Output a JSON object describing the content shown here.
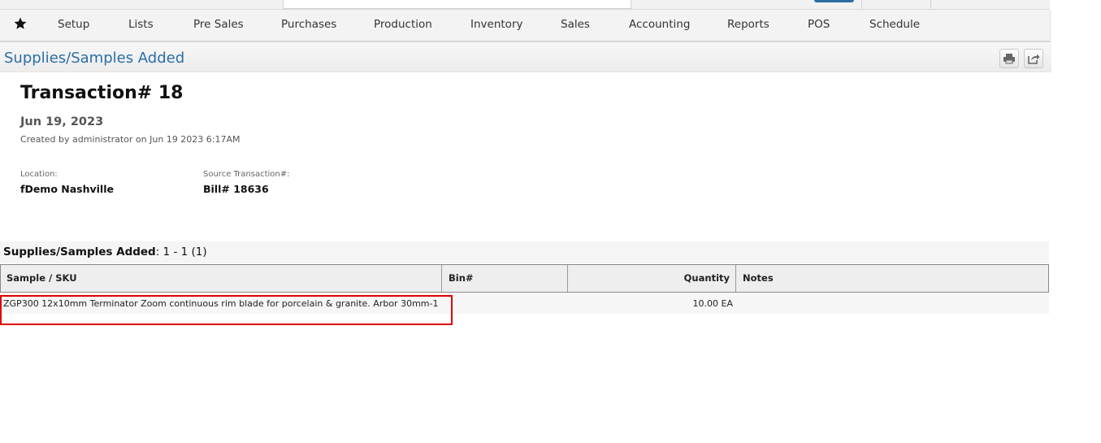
{
  "nav": {
    "favorites_icon": "star-icon",
    "items": [
      "Setup",
      "Lists",
      "Pre Sales",
      "Purchases",
      "Production",
      "Inventory",
      "Sales",
      "Accounting",
      "Reports",
      "POS",
      "Schedule"
    ]
  },
  "header": {
    "title": "Supplies/Samples Added",
    "actions": [
      {
        "icon": "print-icon"
      },
      {
        "icon": "share-icon"
      }
    ]
  },
  "transaction": {
    "title": "Transaction# 18",
    "date": "Jun 19, 2023",
    "created": "Created by administrator on Jun 19 2023 6:17AM",
    "location_label": "Location:",
    "location_value": "fDemo Nashville",
    "source_label": "Source Transaction#:",
    "source_value": "Bill# 18636"
  },
  "section": {
    "title": "Supplies/Samples Added",
    "range": ": 1 - 1 (1)"
  },
  "table": {
    "columns": [
      "Sample / SKU",
      "Bin#",
      "Quantity",
      "Notes"
    ],
    "rows": [
      {
        "sku": "ZGP300 12x10mm Terminator Zoom continuous rim blade for porcelain & granite. Arbor 30mm-1",
        "bin": "",
        "quantity": "10.00 EA",
        "notes": ""
      }
    ]
  },
  "colors": {
    "accent": "#2c6ea8",
    "highlight": "#e00000"
  }
}
